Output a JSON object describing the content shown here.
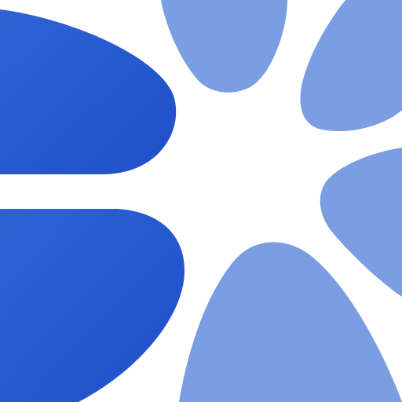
{
  "logo": {
    "icon": "abstract-petal-logo",
    "shapes": {
      "upper_left": "blob-shape",
      "lower_left": "blob-shape",
      "top_petal": "petal-shape",
      "upper_right_petal": "petal-shape",
      "right_petal": "petal-shape",
      "bottom_petal": "petal-shape"
    }
  },
  "colors": {
    "background": "#ffffff",
    "dark_blue_start": "#2f63d4",
    "dark_blue_end": "#1e4fca",
    "light_blue": "#7b9de1"
  }
}
